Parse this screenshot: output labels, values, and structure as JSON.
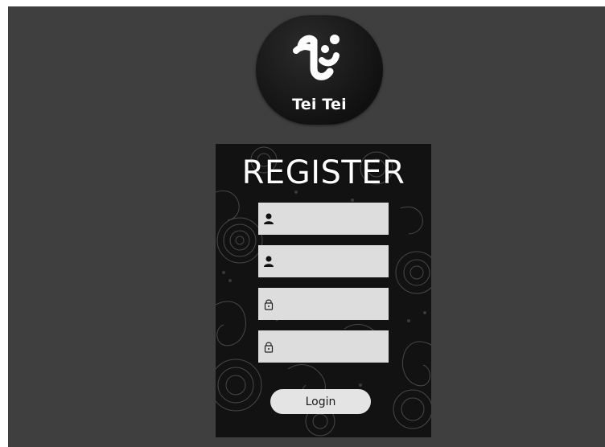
{
  "logo": {
    "text": "Tei Tei"
  },
  "form": {
    "title": "REGISTER",
    "fields": [
      {
        "icon": "user-icon",
        "value": ""
      },
      {
        "icon": "user-icon",
        "value": ""
      },
      {
        "icon": "lock-icon",
        "value": ""
      },
      {
        "icon": "lock-icon",
        "value": ""
      }
    ],
    "submit_label": "Login"
  },
  "colors": {
    "background": "#3f3f3f",
    "panel": "#121212",
    "field": "#dddddd",
    "button": "#e4e4e4"
  }
}
